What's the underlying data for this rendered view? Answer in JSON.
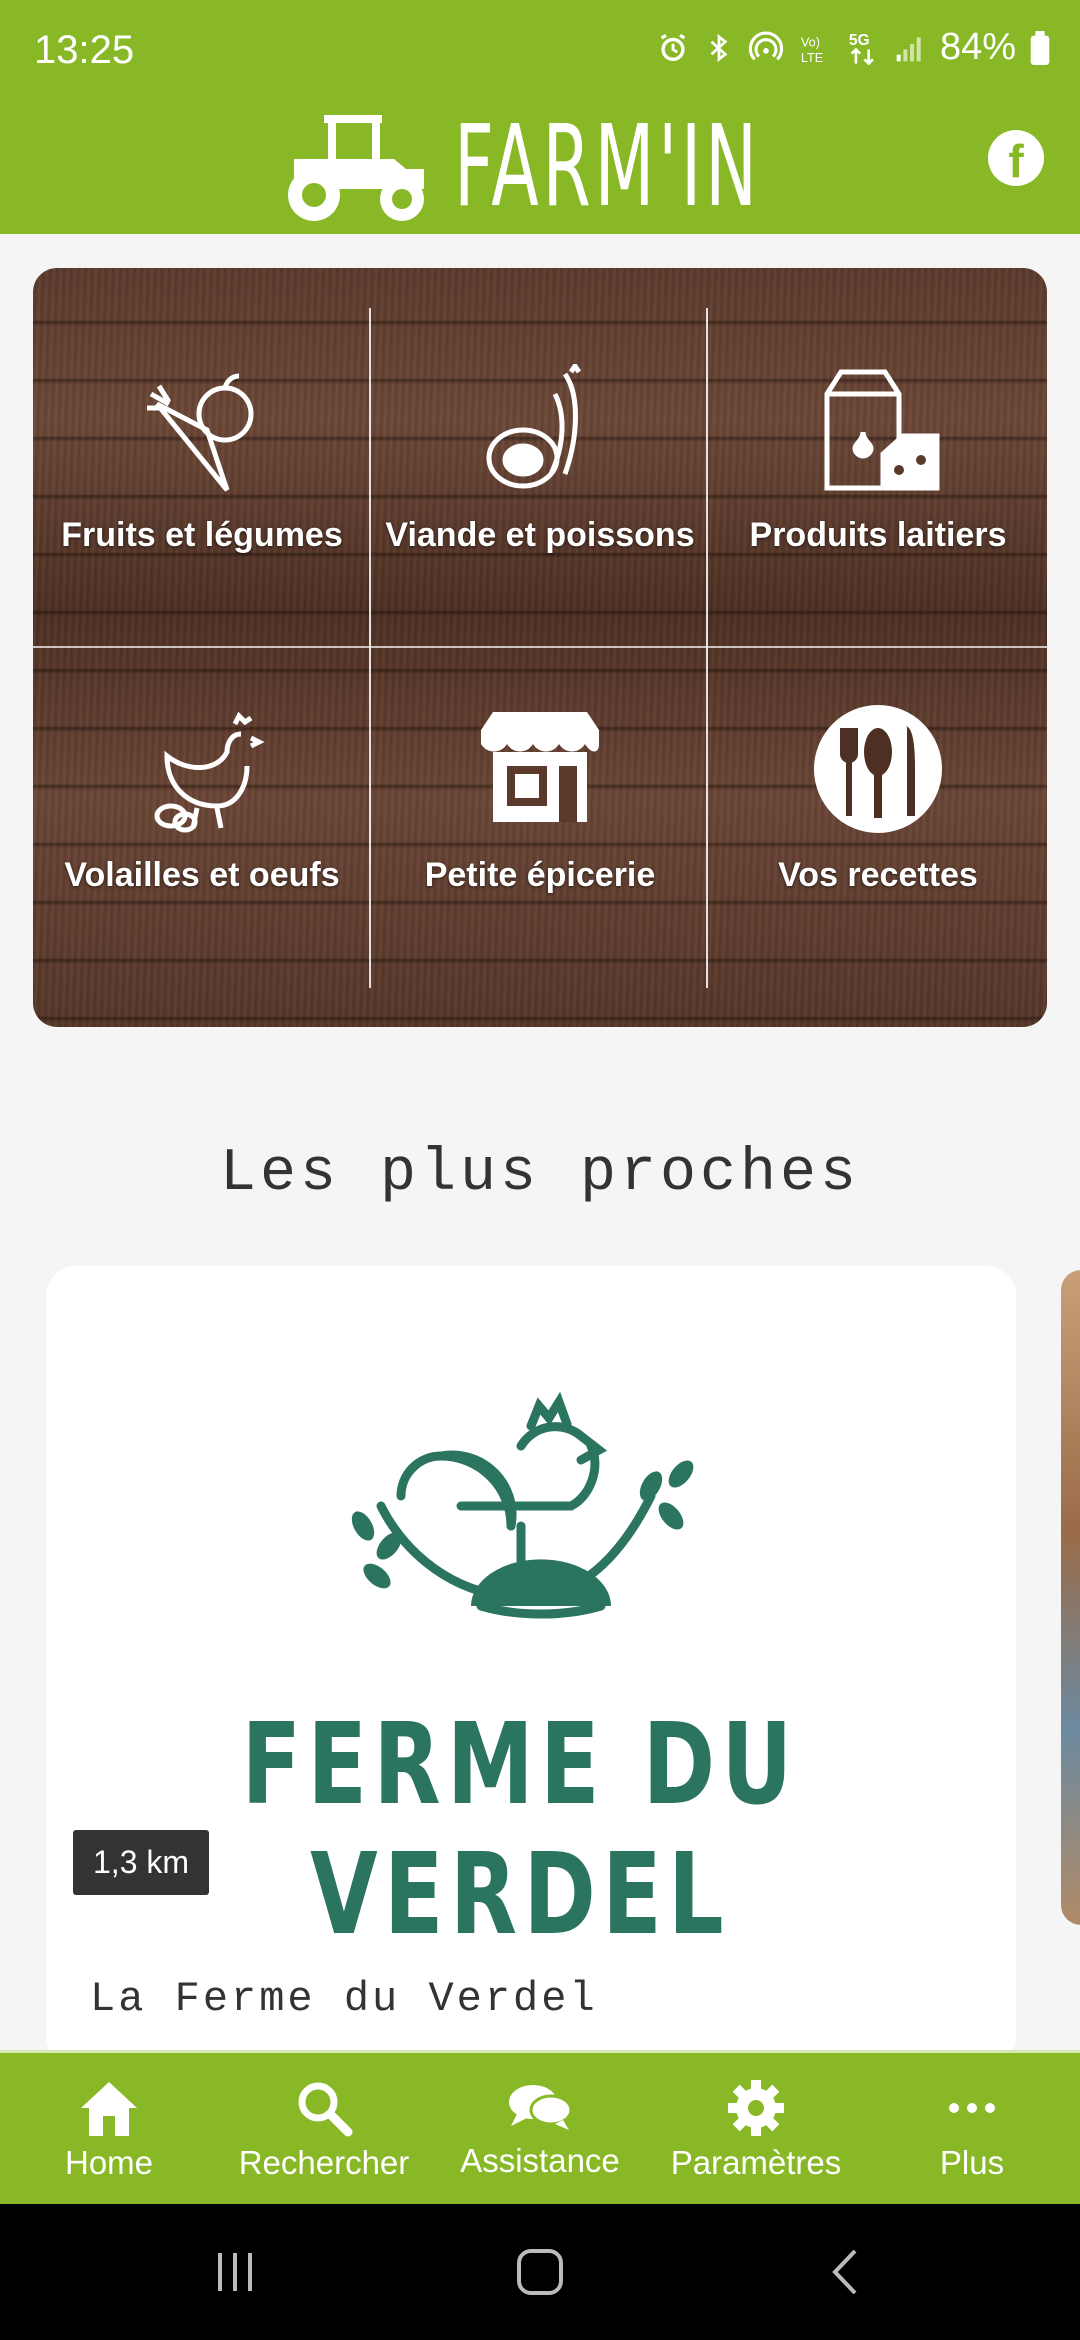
{
  "status_bar": {
    "time": "13:25",
    "battery": "84%",
    "icons": [
      "alarm-icon",
      "bluetooth-icon",
      "hotspot-icon",
      "volte-icon",
      "5g-icon",
      "signal-icon",
      "battery-icon"
    ]
  },
  "header": {
    "app_name": "FARM'IN",
    "brand_color": "#89b826",
    "facebook_icon": "facebook-icon"
  },
  "categories": [
    {
      "label": "Fruits et légumes",
      "icon": "fruits-vegetables-icon"
    },
    {
      "label": "Viande et poissons",
      "icon": "meat-fish-icon"
    },
    {
      "label": "Produits laitiers",
      "icon": "dairy-icon"
    },
    {
      "label": "Volailles et oeufs",
      "icon": "poultry-eggs-icon"
    },
    {
      "label": "Petite épicerie",
      "icon": "grocery-shop-icon"
    },
    {
      "label": "Vos recettes",
      "icon": "recipes-icon"
    }
  ],
  "nearest": {
    "title": "Les plus proches",
    "cards": [
      {
        "logo_text": "FERME DU VERDEL",
        "distance": "1,3 km",
        "name": "La Ferme du Verdel",
        "logo_color": "#2b7560"
      }
    ]
  },
  "bottom_nav": [
    {
      "label": "Home",
      "icon": "home-icon"
    },
    {
      "label": "Rechercher",
      "icon": "search-icon"
    },
    {
      "label": "Assistance",
      "icon": "chat-icon"
    },
    {
      "label": "Paramètres",
      "icon": "gear-icon"
    },
    {
      "label": "Plus",
      "icon": "more-icon"
    }
  ],
  "system_nav": [
    "recents-button",
    "home-button",
    "back-button"
  ]
}
